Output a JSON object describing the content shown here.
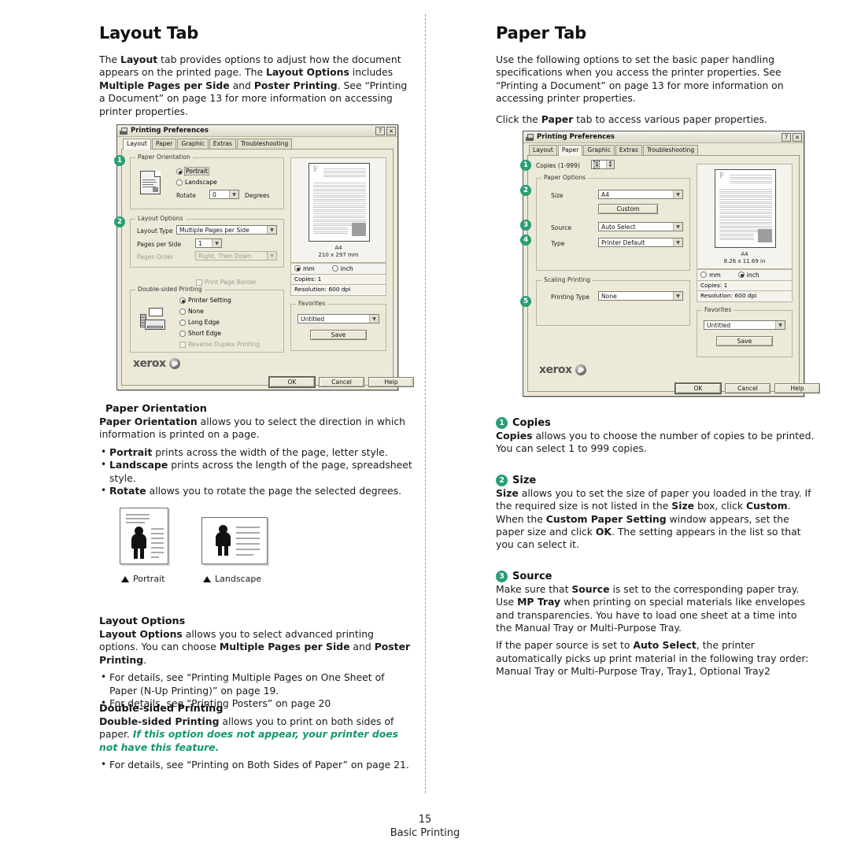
{
  "left_column": {
    "title": "Layout Tab",
    "intro_parts": [
      {
        "t": "The ",
        "b": false
      },
      {
        "t": "Layout",
        "b": true
      },
      {
        "t": " tab provides options to adjust how the document appears on the printed page. The ",
        "b": false
      },
      {
        "t": "Layout Options",
        "b": true
      },
      {
        "t": " includes ",
        "b": false
      },
      {
        "t": "Multiple Pages per Side",
        "b": true
      },
      {
        "t": " and ",
        "b": false
      },
      {
        "t": "Poster Printing",
        "b": true
      },
      {
        "t": ". See “Printing a Document” on page 13 for more information on accessing printer properties.",
        "b": false
      }
    ],
    "paper_orientation": {
      "heading": "Paper Orientation",
      "para_parts": [
        {
          "t": "Paper Orientation",
          "b": true
        },
        {
          "t": " allows you to select the direction in which information is printed on a page.",
          "b": false
        }
      ],
      "bullets": [
        [
          {
            "t": "Portrait",
            "b": true
          },
          {
            "t": " prints across the width of the page, letter style.",
            "b": false
          }
        ],
        [
          {
            "t": "Landscape",
            "b": true
          },
          {
            "t": " prints across the length of the page, spreadsheet style.",
            "b": false
          }
        ],
        [
          {
            "t": "Rotate",
            "b": true
          },
          {
            "t": " allows you to rotate the page the selected degrees.",
            "b": false
          }
        ]
      ]
    },
    "figures": {
      "portrait_caption": "Portrait",
      "landscape_caption": "Landscape"
    },
    "layout_options": {
      "heading": "Layout Options",
      "para_parts": [
        {
          "t": "Layout Options",
          "b": true
        },
        {
          "t": " allows you to select advanced printing options. You can choose ",
          "b": false
        },
        {
          "t": "Multiple Pages per Side",
          "b": true
        },
        {
          "t": " and ",
          "b": false
        },
        {
          "t": "Poster Printing",
          "b": true
        },
        {
          "t": ".",
          "b": false
        }
      ],
      "bullets": [
        [
          {
            "t": "For details, see “Printing Multiple Pages on One Sheet of Paper (N-Up Printing)” on page 19.",
            "b": false
          }
        ],
        [
          {
            "t": "For details, see “Printing Posters” on page 20",
            "b": false
          }
        ]
      ]
    },
    "double_sided": {
      "heading": "Double-sided Printing",
      "para_parts": [
        {
          "t": "Double-sided Printing",
          "b": true
        },
        {
          "t": " allows you to print on both sides of paper. ",
          "b": false
        },
        {
          "t": "If this option does not appear, your printer does not have this feature.",
          "b": false,
          "green": true
        }
      ],
      "bullets": [
        [
          {
            "t": "For details, see “Printing on Both Sides of Paper” on page 21.",
            "b": false
          }
        ]
      ]
    }
  },
  "right_column": {
    "title": "Paper Tab",
    "intro": "Use the following options to set the basic paper handling specifications when you access the printer properties. See “Printing a Document” on page 13 for more information on accessing printer properties.",
    "intro2_parts": [
      {
        "t": "Click the ",
        "b": false
      },
      {
        "t": "Paper",
        "b": true
      },
      {
        "t": " tab to access various paper properties.",
        "b": false
      }
    ],
    "sections": [
      {
        "num": "1",
        "heading": "Copies",
        "para_parts": [
          {
            "t": "Copies",
            "b": true
          },
          {
            "t": " allows you to choose the number of copies to be printed. You can select 1 to 999 copies.",
            "b": false
          }
        ]
      },
      {
        "num": "2",
        "heading": "Size",
        "para_parts": [
          {
            "t": "Size",
            "b": true
          },
          {
            "t": " allows you to set the size of paper you loaded in the tray. If the required size is not listed in the ",
            "b": false
          },
          {
            "t": "Size",
            "b": true
          },
          {
            "t": " box, click ",
            "b": false
          },
          {
            "t": "Custom",
            "b": true
          },
          {
            "t": ". When the ",
            "b": false
          },
          {
            "t": "Custom Paper Setting",
            "b": true
          },
          {
            "t": " window appears, set the paper size and click ",
            "b": false
          },
          {
            "t": "OK",
            "b": true
          },
          {
            "t": ". The setting appears in the list so that you can select it.",
            "b": false
          }
        ]
      },
      {
        "num": "3",
        "heading": "Source",
        "para_parts": [
          {
            "t": "Make sure that ",
            "b": false
          },
          {
            "t": "Source",
            "b": true
          },
          {
            "t": " is set to the corresponding paper tray. Use ",
            "b": false
          },
          {
            "t": "MP Tray",
            "b": true
          },
          {
            "t": " when printing on special materials like envelopes and transparencies. You have to load one sheet at a time into the Manual Tray or Multi-Purpose Tray.",
            "b": false
          }
        ],
        "para2_parts": [
          {
            "t": "If the paper source is set to ",
            "b": false
          },
          {
            "t": "Auto Select",
            "b": true
          },
          {
            "t": ", the printer automatically picks up print material in the following tray order: Manual Tray or Multi-Purpose Tray, Tray1, Optional Tray2",
            "b": false
          }
        ]
      }
    ]
  },
  "dialog_layout": {
    "title": "Printing Preferences",
    "help_button": "?",
    "close_button": "×",
    "tabs": [
      "Layout",
      "Paper",
      "Graphic",
      "Extras",
      "Troubleshooting"
    ],
    "active_tab": "Layout",
    "badges": [
      "1",
      "2"
    ],
    "paper_orientation": {
      "legend": "Paper Orientation",
      "portrait": "Portrait",
      "landscape": "Landscape",
      "selected": "Portrait",
      "rotate_label": "Rotate",
      "rotate_value": "0",
      "degrees_label": "Degrees"
    },
    "layout_options": {
      "legend": "Layout Options",
      "layout_type_label": "Layout Type",
      "layout_type_value": "Multiple Pages per Side",
      "pages_per_side_label": "Pages per Side",
      "pages_per_side_value": "1",
      "pages_order_label": "Pages Order",
      "pages_order_value": "Right, Then Down",
      "print_page_border": "Print Page Border"
    },
    "double_sided": {
      "legend": "Double-sided Printing",
      "options": [
        "Printer Setting",
        "None",
        "Long Edge",
        "Short Edge"
      ],
      "selected": "Printer Setting",
      "reverse_duplex": "Reverse Duplex Printing"
    },
    "preview": {
      "page_letter": "F",
      "size_name": "A4",
      "size_dims": "210 x 297 mm",
      "unit_mm": "mm",
      "unit_inch": "inch",
      "unit_selected": "mm",
      "copies": "Copies: 1",
      "resolution": "Resolution: 600 dpi"
    },
    "favorites": {
      "legend": "Favorites",
      "value": "Untitled",
      "save_button": "Save"
    },
    "brand": "xerox",
    "buttons": [
      "OK",
      "Cancel",
      "Help"
    ]
  },
  "dialog_paper": {
    "title": "Printing Preferences",
    "help_button": "?",
    "close_button": "×",
    "tabs": [
      "Layout",
      "Paper",
      "Graphic",
      "Extras",
      "Troubleshooting"
    ],
    "active_tab": "Paper",
    "badges": [
      "1",
      "2",
      "3",
      "4",
      "5"
    ],
    "copies_label": "Copies (1-999)",
    "copies_value": "1",
    "paper_options": {
      "legend": "Paper Options",
      "size_label": "Size",
      "size_value": "A4",
      "custom_button": "Custom",
      "source_label": "Source",
      "source_value": "Auto Select",
      "type_label": "Type",
      "type_value": "Printer Default"
    },
    "scaling": {
      "legend": "Scaling Printing",
      "printing_type_label": "Printing Type",
      "printing_type_value": "None"
    },
    "preview": {
      "page_letter": "F",
      "size_name": "A4",
      "size_dims": "8.26 x 11.69 in",
      "unit_mm": "mm",
      "unit_inch": "inch",
      "unit_selected": "inch",
      "copies": "Copies: 1",
      "resolution": "Resolution: 600 dpi"
    },
    "favorites": {
      "legend": "Favorites",
      "value": "Untitled",
      "save_button": "Save"
    },
    "brand": "xerox",
    "buttons": [
      "OK",
      "Cancel",
      "Help"
    ]
  },
  "footer": {
    "page_number": "15",
    "text": "Basic Printing"
  },
  "colors": {
    "accent_green": "#2a9d73",
    "emphasis_green": "#16976b",
    "dialog_face": "#ece9d8"
  }
}
